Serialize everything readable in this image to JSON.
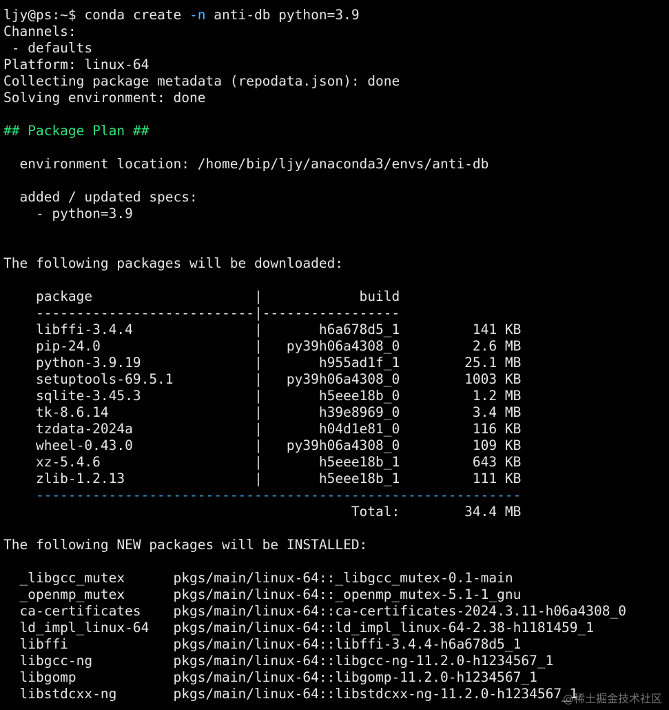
{
  "terminal": {
    "lines": [
      {
        "kind": "cmd",
        "prompt": "ljy@ps:~$ ",
        "pre": "conda create ",
        "flag": "-n",
        "post": " anti-db python=3.9"
      },
      {
        "kind": "text",
        "text": "Channels:"
      },
      {
        "kind": "text",
        "text": " - defaults"
      },
      {
        "kind": "text",
        "text": "Platform: linux-64"
      },
      {
        "kind": "text",
        "text": "Collecting package metadata (repodata.json): done"
      },
      {
        "kind": "text",
        "text": "Solving environment: done"
      },
      {
        "kind": "blank",
        "text": ""
      },
      {
        "kind": "header",
        "text": "## Package Plan ##"
      },
      {
        "kind": "blank",
        "text": ""
      },
      {
        "kind": "text",
        "text": "  environment location: /home/bip/ljy/anaconda3/envs/anti-db"
      },
      {
        "kind": "blank",
        "text": ""
      },
      {
        "kind": "text",
        "text": "  added / updated specs:"
      },
      {
        "kind": "text",
        "text": "    - python=3.9"
      },
      {
        "kind": "blank",
        "text": ""
      },
      {
        "kind": "blank",
        "text": ""
      },
      {
        "kind": "text",
        "text": "The following packages will be downloaded:"
      },
      {
        "kind": "blank",
        "text": ""
      },
      {
        "kind": "text",
        "text": "    package                    |            build"
      },
      {
        "kind": "text",
        "text": "    ---------------------------|-----------------"
      },
      {
        "kind": "text",
        "text": "    libffi-3.4.4               |       h6a678d5_1         141 KB"
      },
      {
        "kind": "text",
        "text": "    pip-24.0                   |   py39h06a4308_0         2.6 MB"
      },
      {
        "kind": "text",
        "text": "    python-3.9.19              |       h955ad1f_1        25.1 MB"
      },
      {
        "kind": "text",
        "text": "    setuptools-69.5.1          |   py39h06a4308_0        1003 KB"
      },
      {
        "kind": "text",
        "text": "    sqlite-3.45.3              |       h5eee18b_0         1.2 MB"
      },
      {
        "kind": "text",
        "text": "    tk-8.6.14                  |       h39e8969_0         3.4 MB"
      },
      {
        "kind": "text",
        "text": "    tzdata-2024a               |       h04d1e81_0         116 KB"
      },
      {
        "kind": "text",
        "text": "    wheel-0.43.0               |   py39h06a4308_0         109 KB"
      },
      {
        "kind": "text",
        "text": "    xz-5.4.6                   |       h5eee18b_1         643 KB"
      },
      {
        "kind": "text",
        "text": "    zlib-1.2.13                |       h5eee18b_1         111 KB"
      },
      {
        "kind": "dash",
        "text": "    ------------------------------------------------------------"
      },
      {
        "kind": "text",
        "text": "                                           Total:        34.4 MB"
      },
      {
        "kind": "blank",
        "text": ""
      },
      {
        "kind": "text",
        "text": "The following NEW packages will be INSTALLED:"
      },
      {
        "kind": "blank",
        "text": ""
      },
      {
        "kind": "text",
        "text": "  _libgcc_mutex      pkgs/main/linux-64::_libgcc_mutex-0.1-main"
      },
      {
        "kind": "text",
        "text": "  _openmp_mutex      pkgs/main/linux-64::_openmp_mutex-5.1-1_gnu"
      },
      {
        "kind": "text",
        "text": "  ca-certificates    pkgs/main/linux-64::ca-certificates-2024.3.11-h06a4308_0"
      },
      {
        "kind": "text",
        "text": "  ld_impl_linux-64   pkgs/main/linux-64::ld_impl_linux-64-2.38-h1181459_1"
      },
      {
        "kind": "text",
        "text": "  libffi             pkgs/main/linux-64::libffi-3.4.4-h6a678d5_1"
      },
      {
        "kind": "text",
        "text": "  libgcc-ng          pkgs/main/linux-64::libgcc-ng-11.2.0-h1234567_1"
      },
      {
        "kind": "text",
        "text": "  libgomp            pkgs/main/linux-64::libgomp-11.2.0-h1234567_1"
      },
      {
        "kind": "text",
        "text": "  libstdcxx-ng       pkgs/main/linux-64::libstdcxx-ng-11.2.0-h1234567_1"
      }
    ]
  },
  "watermark": {
    "text": "@稀土掘金技术社区"
  },
  "colors": {
    "background": "#000000",
    "text": "#e6e6e6",
    "header_green": "#2ee07a",
    "dash_blue": "#3aa0e0",
    "flag_blue": "#4fb3ff"
  }
}
